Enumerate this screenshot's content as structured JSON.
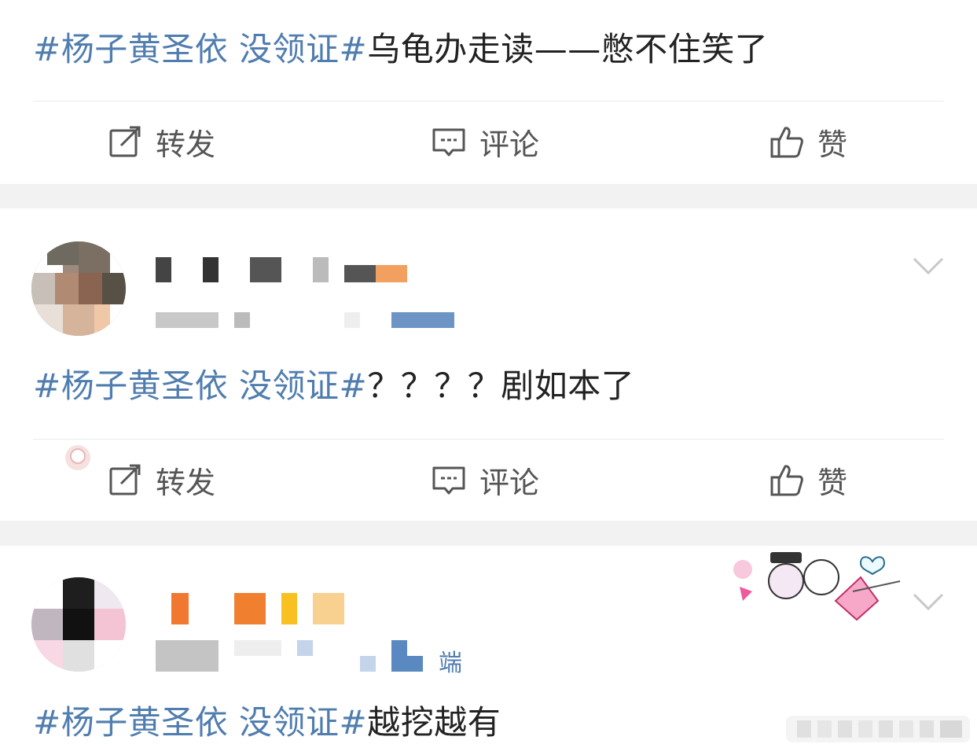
{
  "posts": [
    {
      "hashtag": "#杨子黄圣依 没领证#",
      "text": "乌龟办走读——憋不住笑了"
    },
    {
      "hashtag": "#杨子黄圣依 没领证#",
      "text": "？？？？剧如本了"
    },
    {
      "hashtag": "#杨子黄圣依 没领证#",
      "text": "越挖越有",
      "source_suffix": "端"
    }
  ],
  "actions": {
    "repost": "转发",
    "comment": "评论",
    "like": "赞"
  },
  "colors": {
    "hashtag": "#507daf",
    "text": "#222222",
    "action_label": "#555555",
    "separator": "#f2f2f2"
  },
  "icons": {
    "repost": "repost-icon",
    "comment": "comment-icon",
    "like": "thumbs-up-icon",
    "menu": "chevron-down-icon"
  }
}
